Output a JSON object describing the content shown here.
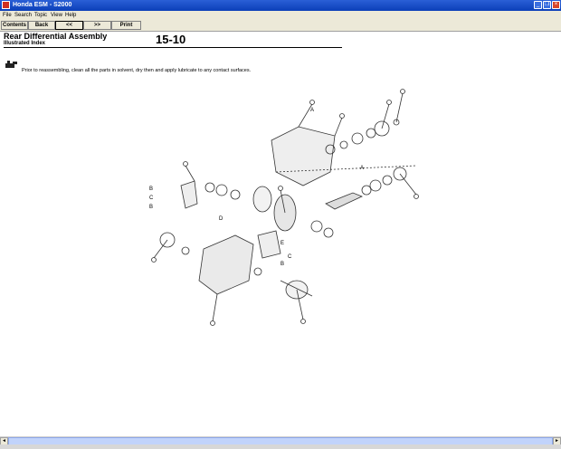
{
  "window": {
    "title": "Honda ESM - S2000",
    "controls": {
      "minimize": "_",
      "restore": "❐",
      "close": "×"
    }
  },
  "menu": {
    "items": [
      "File",
      "Search",
      "Topic",
      "View",
      "Help"
    ]
  },
  "toolbar": {
    "contents_label": "Contents",
    "back_label": "Back",
    "prev_label": "<<",
    "next_label": ">>",
    "print_label": "Print"
  },
  "content": {
    "title": "Rear Differential Assembly",
    "subtitle": "Illustrated Index",
    "page_number": "15-10",
    "instruction": "Prior to reassembling, clean all the parts in solvent, dry then and apply lubricate to any contact surfaces."
  },
  "diagram": {
    "letters": {
      "a": "A",
      "b": "B",
      "c": "C",
      "d": "D",
      "e": "E"
    }
  },
  "scrollbar": {
    "left_arrow": "◄",
    "right_arrow": "►"
  }
}
